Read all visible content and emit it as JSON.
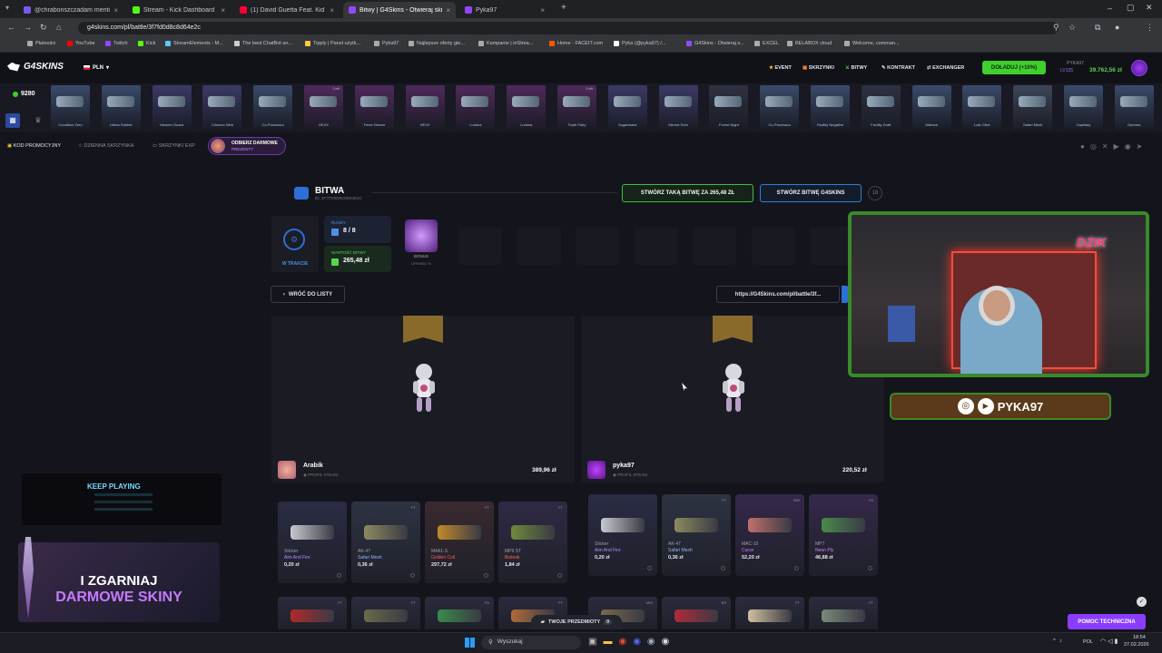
{
  "browser": {
    "tabs": [
      {
        "label": "@chrabonszczadam menti",
        "color": "#7b58f0",
        "active": false
      },
      {
        "label": "Stream - Kick Dashboard",
        "color": "#53fc18",
        "active": false
      },
      {
        "label": "(1) David Guetta Feat. Kid C",
        "color": "#ff0033",
        "active": false
      },
      {
        "label": "Bitwy | G4Skins - Otwieraj skrz",
        "color": "#8f4bff",
        "active": true
      },
      {
        "label": "Pyka97",
        "color": "#9146ff",
        "active": false
      }
    ],
    "new_tab": "+",
    "url": "g4skins.com/pl/battle/3f7fd0d8c8d64e2c",
    "bookmarks": [
      "Płatności",
      "YouTube",
      "Twitch",
      "Kick",
      "StreamElements - M...",
      "The best ChatBot an...",
      "Tipply | Panel użytk...",
      "Pyka97",
      "Najlepsze oferty gie...",
      "Kampanie | inStrea...",
      "Home - FACEIT.com",
      "Pyka (@pyka97) /...",
      "G4Skins - Otwieraj s...",
      "EXCEL",
      "BELABOX cloud",
      "Welcome, comman..."
    ]
  },
  "site": {
    "logo": "G4SKINS",
    "currency": "PLN",
    "nav": [
      {
        "label": "EVENT",
        "icon": "star-icon"
      },
      {
        "label": "SKRZYNKI",
        "icon": "box-icon"
      },
      {
        "label": "BITWY",
        "icon": "battle-icon"
      },
      {
        "label": "KONTRAKT",
        "icon": "pen-icon"
      },
      {
        "label": "EXCHANGER",
        "icon": "exchange-icon"
      }
    ],
    "deposit": "DOŁADUJ (+10%)",
    "user_name": "PYKA97",
    "user_level": "LV125",
    "balance": "39.762,56 zł",
    "coins": "9280",
    "strip_items": [
      {
        "name": "Condition Zero",
        "color": "#3a4a6a",
        "tag": ""
      },
      {
        "name": "Urban Rubble",
        "color": "#3a4a6a",
        "tag": ""
      },
      {
        "name": "Heaven Guard",
        "color": "#3a3a66",
        "tag": ""
      },
      {
        "name": "Crimson Web",
        "color": "#3a3a66",
        "tag": ""
      },
      {
        "name": "Co-Processor",
        "color": "#3a4a6a",
        "tag": ""
      },
      {
        "name": "HEXX",
        "color": "#4e2a5a",
        "tag": "2 left"
      },
      {
        "name": "Fever Dream",
        "color": "#4e2a5a",
        "tag": ""
      },
      {
        "name": "HEXX",
        "color": "#4e2a5a",
        "tag": ""
      },
      {
        "name": "Lumina",
        "color": "#4e2a5a",
        "tag": ""
      },
      {
        "name": "Lumina",
        "color": "#4e2a5a",
        "tag": ""
      },
      {
        "name": "Tooth Fairy",
        "color": "#4e2a5a",
        "tag": "4 left"
      },
      {
        "name": "Sugarmass",
        "color": "#3a3a66",
        "tag": ""
      },
      {
        "name": "Mecha Tech",
        "color": "#3a3a66",
        "tag": ""
      },
      {
        "name": "Forest Night",
        "color": "#2e3140",
        "tag": ""
      },
      {
        "name": "Co-Processor",
        "color": "#3a4a6a",
        "tag": ""
      },
      {
        "name": "Facility Negative",
        "color": "#3a4a6a",
        "tag": ""
      },
      {
        "name": "Facility Draft",
        "color": "#2e3140",
        "tag": ""
      },
      {
        "name": "Valence",
        "color": "#3a4a6a",
        "tag": ""
      },
      {
        "name": "Lost Olive",
        "color": "#3a4a6a",
        "tag": ""
      },
      {
        "name": "Safari Mesh",
        "color": "#3d4658",
        "tag": ""
      },
      {
        "name": "Capillary",
        "color": "#3a4a6a",
        "tag": ""
      },
      {
        "name": "Gamma",
        "color": "#3a4a6a",
        "tag": ""
      }
    ],
    "subbar": {
      "promo": "KOD PROMOCYJNY",
      "daily": "DZIENNA SKRZYNKA",
      "exp": "SKRZYNKI EXP",
      "free_title": "ODBIERZ DARMOWE",
      "free_sub": "PREZENTY"
    }
  },
  "battle": {
    "title": "BITWA",
    "id": "ID: 3F7FD0D8C8D64E2C",
    "create_same": "STWÓRZ TAKĄ BITWĘ ZA 265,48 ZŁ",
    "create_new": "STWÓRZ BITWĘ G4SKINS",
    "age_badge": "18",
    "status": "W TRAKCIE",
    "rounds_label": "RUNDY",
    "rounds_value": "8 / 8",
    "value_label": "WARTOŚĆ BITWY",
    "value": "265,48 zł",
    "bonus_label": "BONUS",
    "bonus_sub": "OPENED %",
    "back": "WRÓĆ DO LISTY",
    "share_link": "https://G4Skins.com/pl/battle/3f...",
    "players": [
      {
        "name": "Arabik",
        "profile": "PROFIL STEAM",
        "total": "389,96 zł"
      },
      {
        "name": "pyka97",
        "profile": "PROFIL STEAM",
        "total": "220,52 zł"
      }
    ],
    "items_left": [
      {
        "type": "Sticker",
        "name": "Aim And Fire",
        "price": "0,20 zł",
        "cond": "",
        "bg": "#2a2c45",
        "namecolor": "#b78cff",
        "gun": "#c8c8d0"
      },
      {
        "type": "AK-47",
        "name": "Safari Mesh",
        "price": "0,36 zł",
        "cond": "FT",
        "bg": "#2e3344",
        "namecolor": "#8fb5ff",
        "gun": "#8c8a5e"
      },
      {
        "type": "M4A1-S",
        "name": "Golden Coil",
        "price": "297,72 zł",
        "cond": "FT",
        "bg": "#3a2a30",
        "namecolor": "#ff5e5e",
        "gun": "#c08a2a"
      },
      {
        "type": "MP9 ST",
        "name": "Bioleak",
        "price": "1,84 zł",
        "cond": "FT",
        "bg": "#2f2a44",
        "namecolor": "#ff6a3d",
        "gun": "#6f8a3a"
      }
    ],
    "items_right": [
      {
        "type": "Sticker",
        "name": "Aim And Fire",
        "price": "0,20 zł",
        "cond": "",
        "bg": "#2a2c45",
        "namecolor": "#b78cff",
        "gun": "#c8c8d0"
      },
      {
        "type": "AK-47",
        "name": "Safari Mesh",
        "price": "0,36 zł",
        "cond": "FT",
        "bg": "#2e3344",
        "namecolor": "#8fb5ff",
        "gun": "#8c8a5e"
      },
      {
        "type": "MAC-10",
        "name": "Curse",
        "price": "52,20 zł",
        "cond": "MW",
        "bg": "#35284a",
        "namecolor": "#c882ff",
        "gun": "#c0706a"
      },
      {
        "type": "MP7",
        "name": "Neon Ply",
        "price": "46,88 zł",
        "cond": "FN",
        "bg": "#35284a",
        "namecolor": "#c882ff",
        "gun": "#4a8a4a"
      }
    ],
    "mini_left": [
      {
        "cond": "FT",
        "gun": "#b02a2a"
      },
      {
        "cond": "FT",
        "gun": "#6a6a4a"
      },
      {
        "cond": "FN",
        "gun": "#3a8a4a"
      },
      {
        "cond": "FT",
        "gun": "#b06a3a"
      }
    ],
    "mini_right": [
      {
        "cond": "MW",
        "gun": "#7a6a4a"
      },
      {
        "cond": "BS",
        "gun": "#b02a3a"
      },
      {
        "cond": "FT",
        "gun": "#d0c0a0"
      },
      {
        "cond": "FT",
        "gun": "#7a8a7a"
      }
    ],
    "your_items": "TWOJE PRZEDMIOTY",
    "your_items_count": "0",
    "support": "POMOC TECHNICZNA"
  },
  "overlay": {
    "keep_playing": "KEEP PLAYING",
    "promo_line1": "I ZGARNIAJ",
    "promo_line2": "DARMOWE SKINY",
    "cam_handle": "PYKA97",
    "cam_sign": "DZIK"
  },
  "taskbar": {
    "search": "Wyszukaj",
    "lang": "POL",
    "time": "18:54",
    "date": "27.02.2026"
  }
}
